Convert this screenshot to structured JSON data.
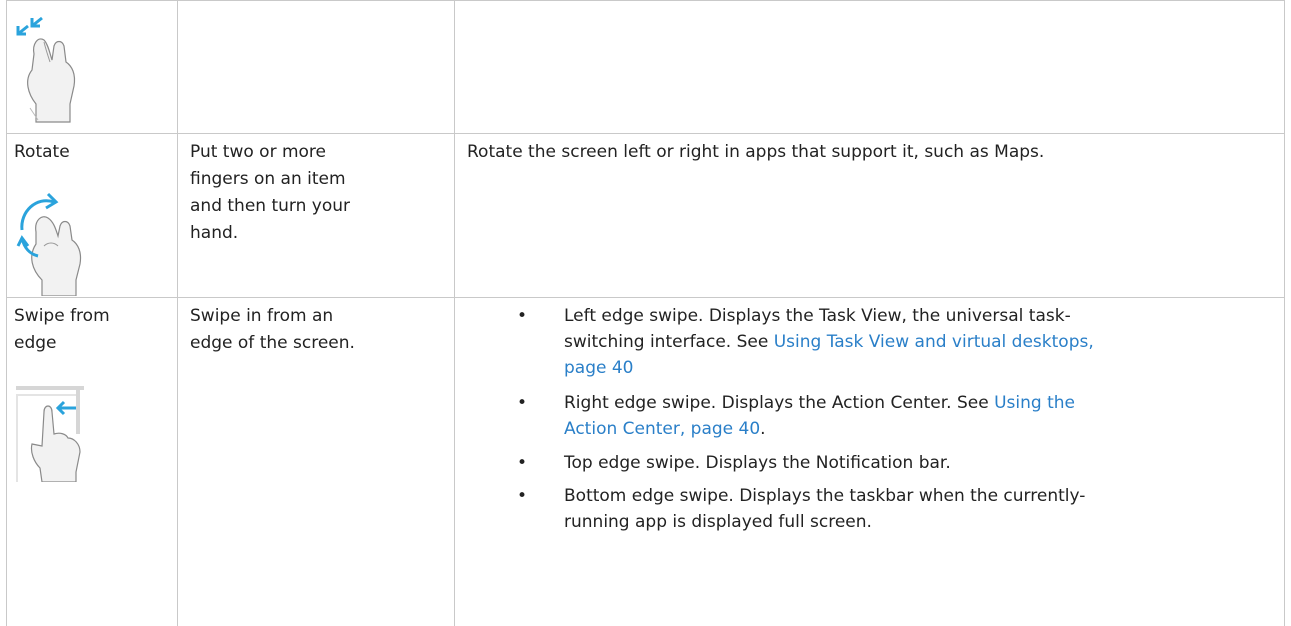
{
  "rows": [
    {
      "name": "",
      "description": "",
      "action": ""
    },
    {
      "name": "Rotate",
      "description_lines": [
        "Put two or more",
        "fingers on an item",
        "and then turn your",
        "hand."
      ],
      "action": "Rotate the screen left or right in apps that support it, such as Maps."
    },
    {
      "name_lines": [
        "Swipe from",
        "edge"
      ],
      "description_lines": [
        "Swipe in from an",
        "edge of the screen."
      ],
      "bullets": [
        {
          "line1": "Left edge swipe. Displays the Task View, the universal task-",
          "line2_prefix": "switching interface. See ",
          "link_line1": "Using Task View and virtual desktops,",
          "link_line2": "page 40",
          "suffix": ""
        },
        {
          "line1_prefix": "Right edge swipe. Displays the Action Center. See ",
          "link_line1": "Using the",
          "link_line2": "Action Center, page 40",
          "suffix": "."
        },
        {
          "line1": "Top edge swipe. Displays the Notification bar."
        },
        {
          "line1": "Bottom edge swipe. Displays the taskbar when the currently-",
          "line2": "running app is displayed full screen."
        }
      ]
    }
  ],
  "bullet_glyph": "•",
  "icons": [
    "pinch-gesture-icon",
    "rotate-gesture-icon",
    "swipe-edge-gesture-icon"
  ],
  "colors": {
    "link": "#2a7fc8",
    "gesture_arrow": "#2aa3dc",
    "border": "#c9c9c9"
  }
}
